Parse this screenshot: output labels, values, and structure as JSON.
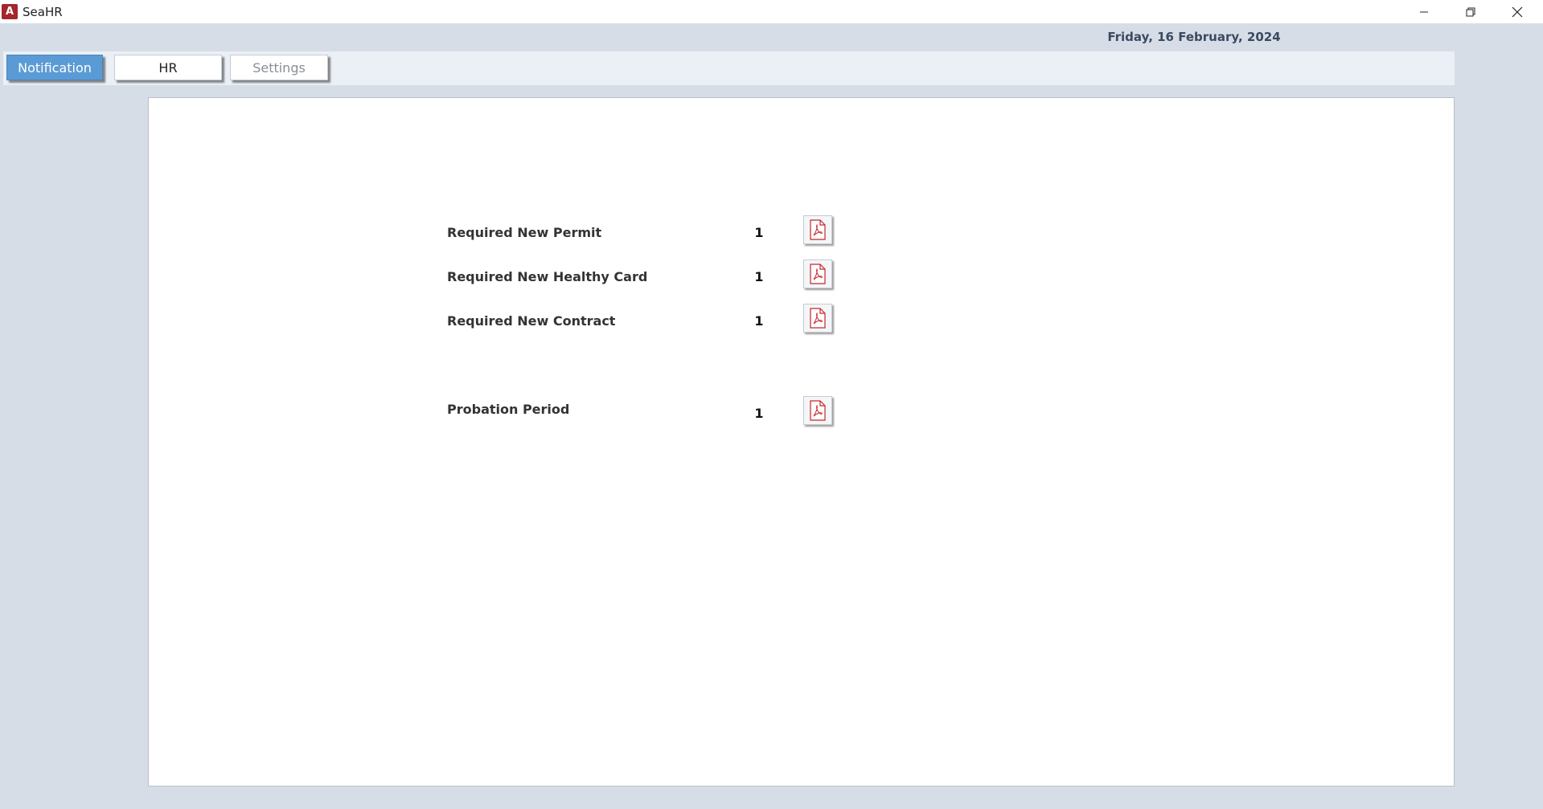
{
  "window": {
    "title": "SeaHR",
    "app_icon_letter": "A",
    "icons": [
      "access-app-icon",
      "minimize-icon",
      "restore-icon",
      "close-icon"
    ]
  },
  "header": {
    "date": "Friday, 16 February, 2024"
  },
  "tabs": [
    {
      "label": "Notification",
      "state": "active"
    },
    {
      "label": "HR",
      "state": "normal"
    },
    {
      "label": "Settings",
      "state": "disabled"
    }
  ],
  "notifications": [
    {
      "label": "Required New Permit",
      "count": "1",
      "icon": "pdf-icon"
    },
    {
      "label": "Required New Healthy Card",
      "count": "1",
      "icon": "pdf-icon"
    },
    {
      "label": "Required New Contract",
      "count": "1",
      "icon": "pdf-icon"
    },
    {
      "label": "Probation Period",
      "count": "1",
      "icon": "pdf-icon"
    }
  ],
  "colors": {
    "active_tab": "#5b9bd5",
    "background": "#d7dde7",
    "pdf_red": "#c8262c"
  }
}
